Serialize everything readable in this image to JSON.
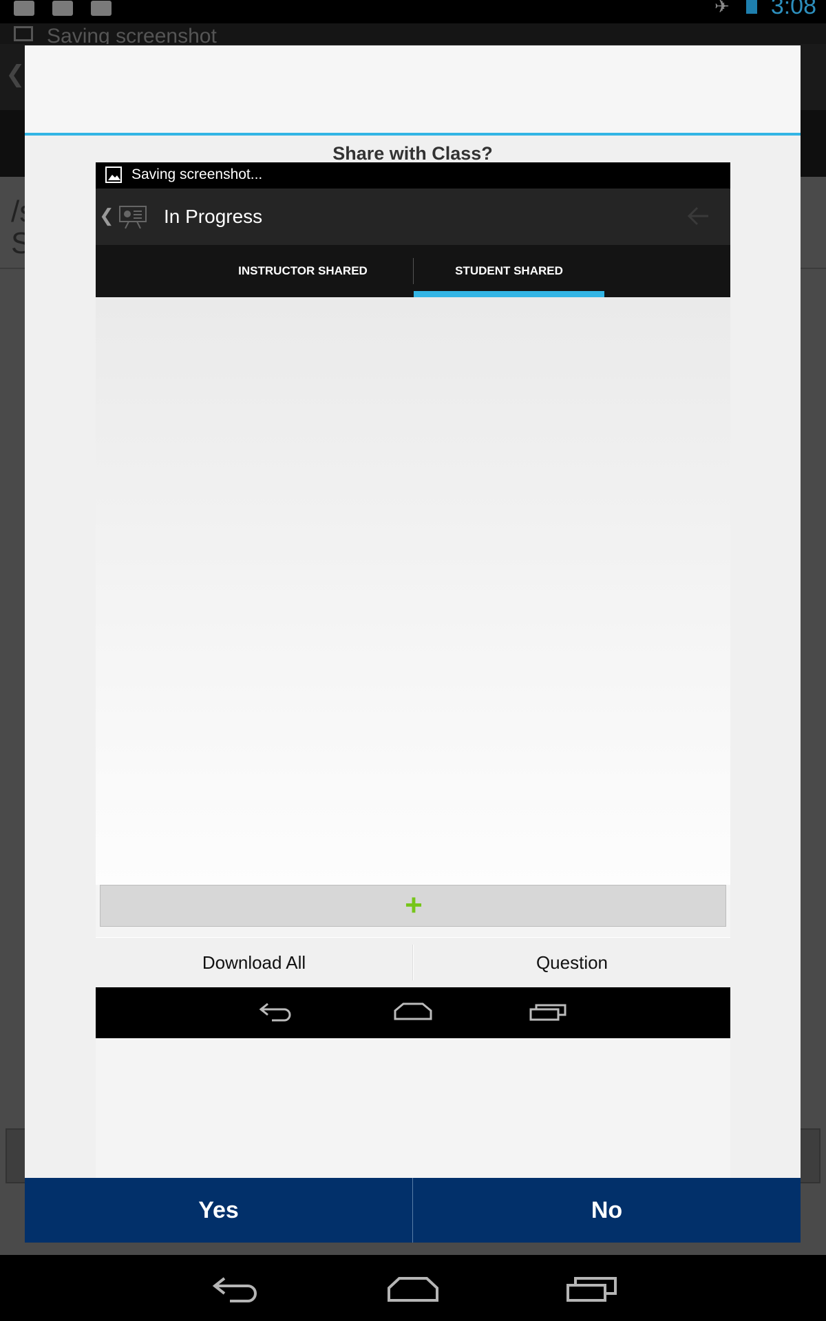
{
  "background": {
    "status_time": "3:08",
    "notice_text": "Saving screenshot",
    "fragment_1": "/s",
    "fragment_2": "S"
  },
  "dialog": {
    "title": "Share with Class?",
    "yes_label": "Yes",
    "no_label": "No"
  },
  "screenshot": {
    "status_text": "Saving screenshot...",
    "app_title": "In Progress",
    "tabs": [
      {
        "label": "INSTRUCTOR SHARED",
        "selected": false
      },
      {
        "label": "STUDENT SHARED",
        "selected": true
      }
    ],
    "add_symbol": "+",
    "footer": {
      "download_all": "Download All",
      "question": "Question"
    }
  },
  "colors": {
    "accent": "#33b5e5",
    "dialog_button_bg": "#02306a",
    "add_plus": "#76c51a"
  }
}
